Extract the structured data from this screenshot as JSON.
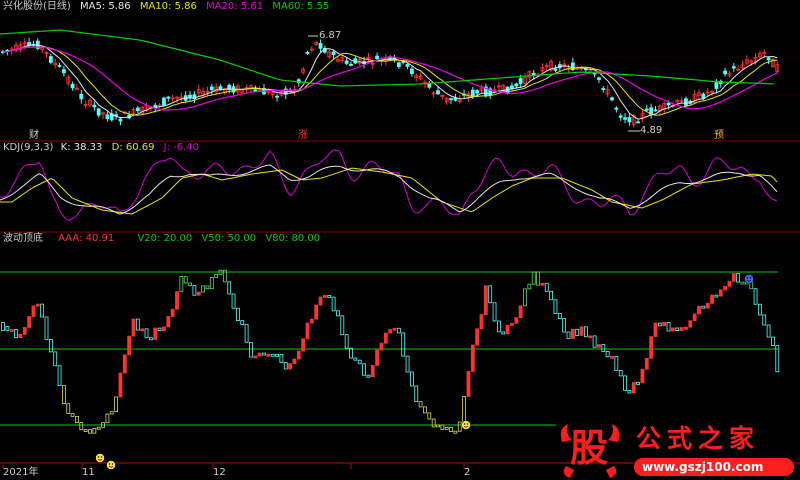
{
  "colors": {
    "bg": "#000000",
    "up": "#ff3232",
    "down": "#54ffff",
    "frame": "#8c0000",
    "ma5": "#e6e6e6",
    "ma10": "#e6e600",
    "ma20": "#e600e6",
    "ma60": "#00d000",
    "k": "#e6e6e6",
    "d": "#e6e600",
    "j": "#d400d4",
    "aaa": "#ff3232",
    "level": "#00cc00",
    "extreme": "#d8d858",
    "extreme_green": "#5adb5a",
    "axis": "#c80000",
    "watermark_red": "#ff1e1e",
    "watermark_white": "#ffffff"
  },
  "main_panel": {
    "title": "兴化股份(日线)",
    "indicators": [
      {
        "label": "MA5: 5.86",
        "color": "#e6e6e6"
      },
      {
        "label": "MA10: 5.86",
        "color": "#e6e600"
      },
      {
        "label": "MA20: 5.61",
        "color": "#e600e6"
      },
      {
        "label": "MA60: 5.55",
        "color": "#00d000"
      }
    ],
    "high_label": "6.87",
    "low_label": "4.89",
    "events": [
      {
        "text": "财",
        "color": "#d0d0d0"
      },
      {
        "text": "涨",
        "color": "#ff3232"
      },
      {
        "text": "预",
        "color": "#ffb020"
      }
    ]
  },
  "kdj_panel": {
    "title": "KDJ(9,3,3)",
    "k_label": "K: 38.33",
    "d_label": "D: 60.69",
    "j_label": "J: -6.40"
  },
  "wave_panel": {
    "title": "波动顶底",
    "aaa_label": "AAA: 40.91",
    "v20_label": "V20: 20.00",
    "v50_label": "V50: 50.00",
    "v80_label": "V80: 80.00"
  },
  "x_axis": {
    "labels": [
      "2021年",
      "11",
      "12",
      "2"
    ]
  },
  "watermark": {
    "gu": "股",
    "brand": "公式之家",
    "url": "www.gszj100.com"
  }
}
